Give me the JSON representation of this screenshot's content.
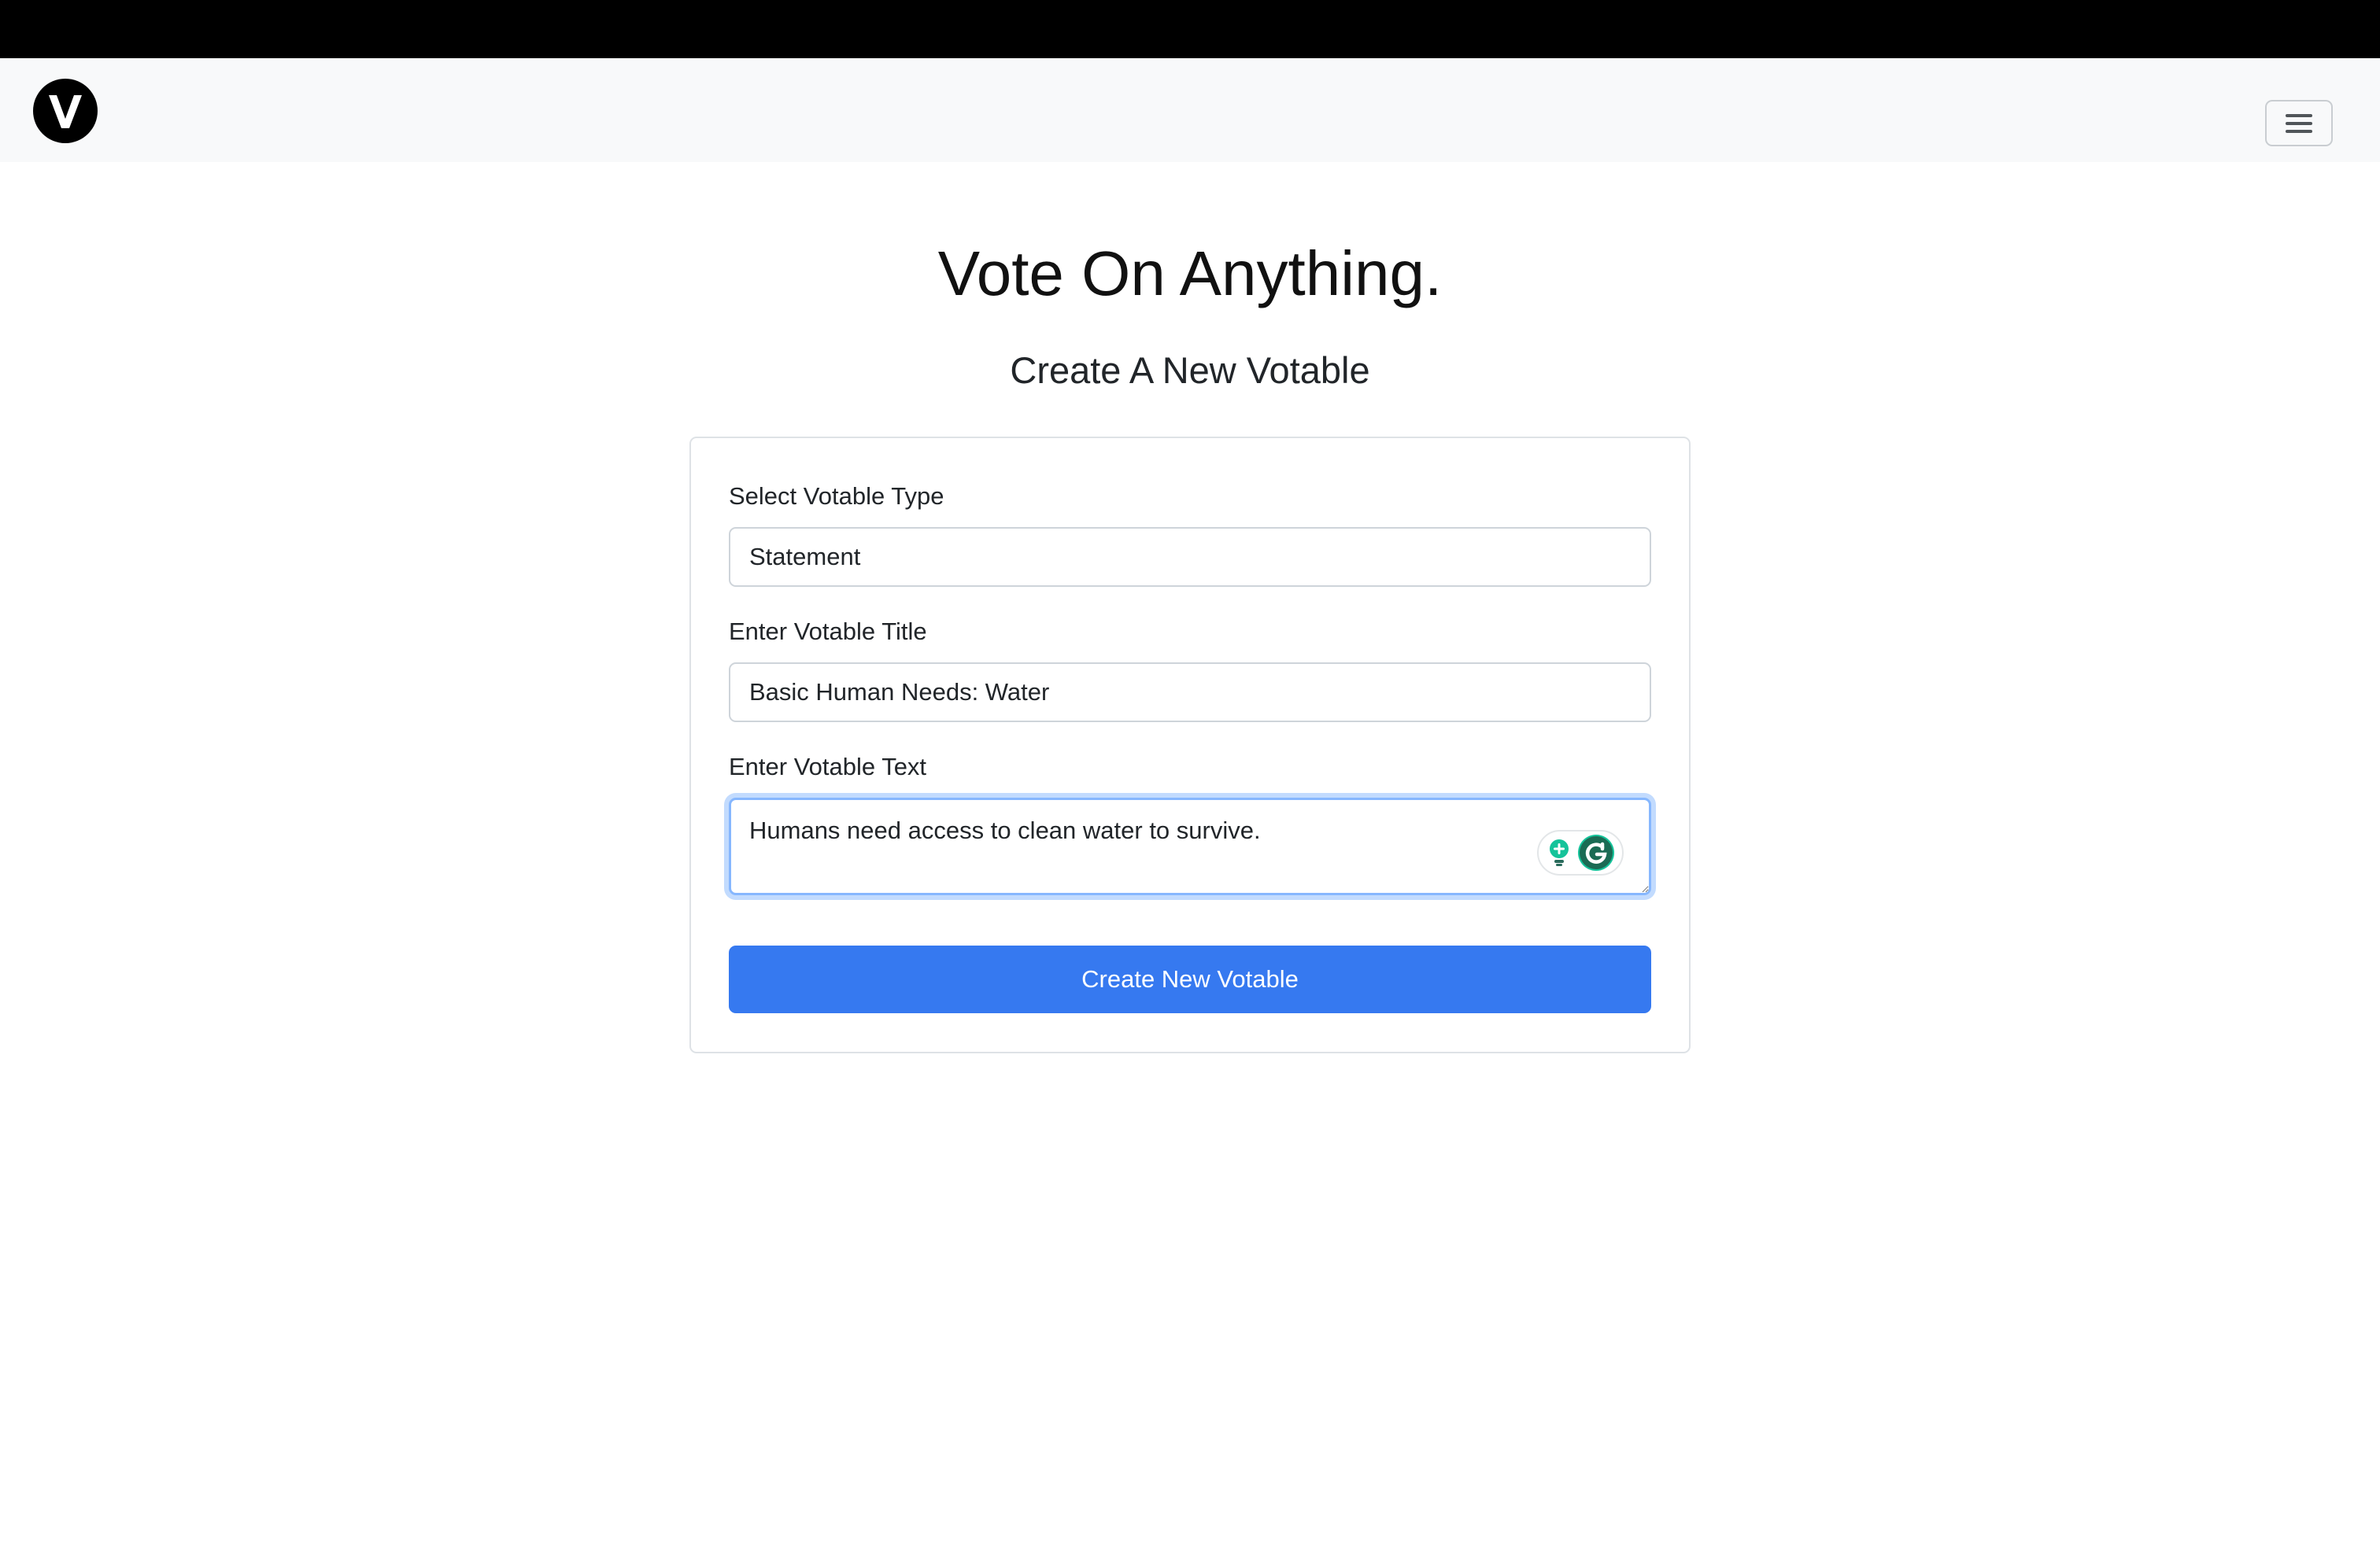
{
  "colors": {
    "top_bar": "#000000",
    "navbar_bg": "#f8f9fa",
    "primary_button": "#3679f0",
    "focus_border": "#86b7fe",
    "grammarly_green": "#15c39a"
  },
  "navbar": {
    "logo_icon": "v-circle-logo",
    "menu_icon": "hamburger-menu-icon"
  },
  "hero": {
    "title": "Vote On Anything.",
    "subtitle": "Create A New Votable"
  },
  "form": {
    "type_label": "Select Votable Type",
    "type_value": "Statement",
    "title_label": "Enter Votable Title",
    "title_value": "Basic Human Needs: Water",
    "text_label": "Enter Votable Text",
    "text_value": "Humans need access to clean water to survive.",
    "submit_label": "Create New Votable"
  },
  "grammarly": {
    "suggestion_icon": "lightbulb-icon",
    "badge_icon": "grammarly-g-icon"
  }
}
